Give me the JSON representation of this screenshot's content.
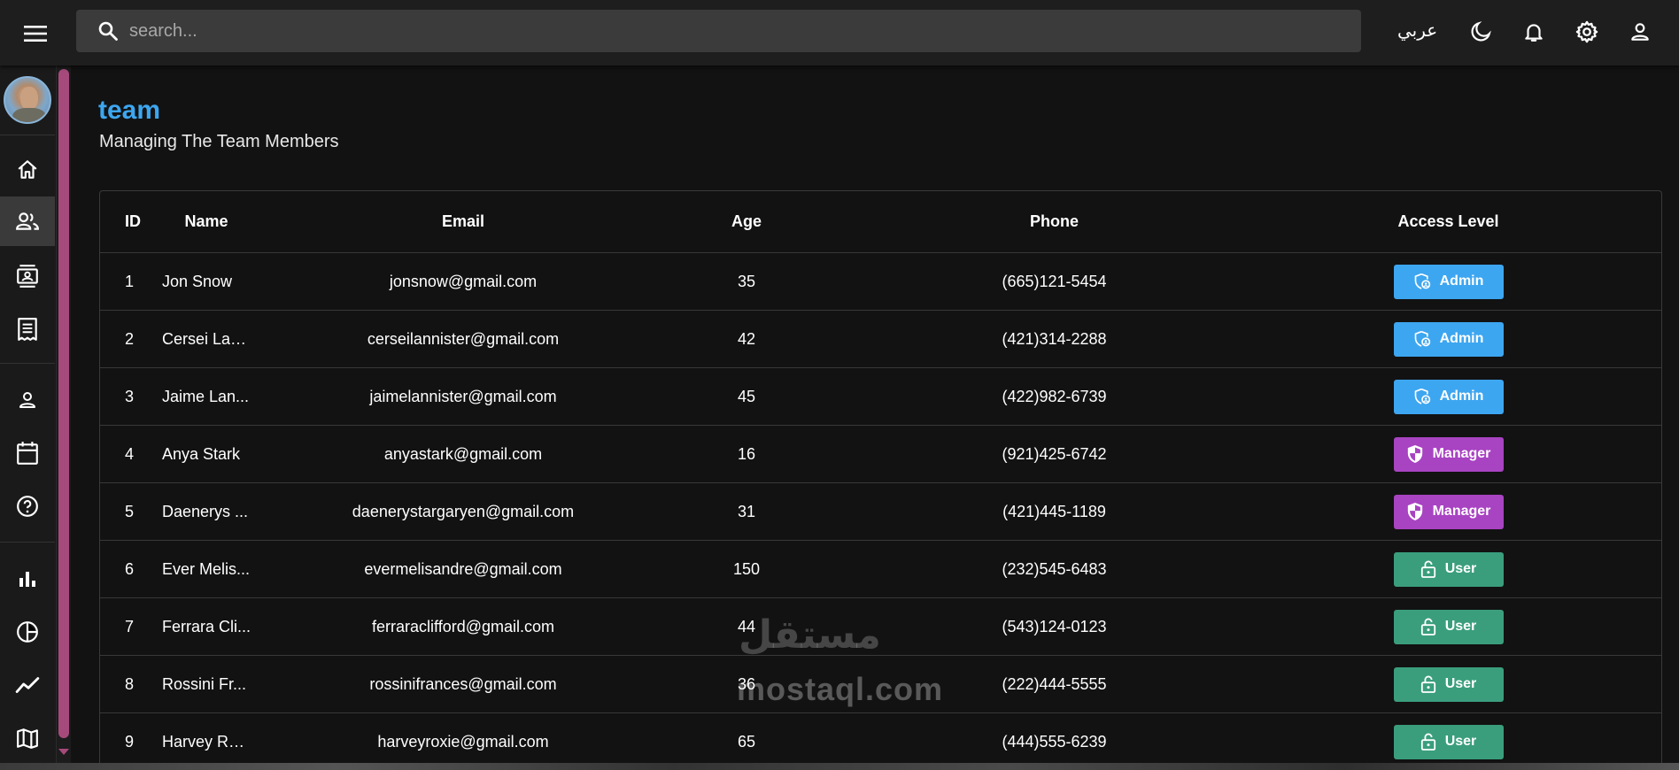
{
  "topbar": {
    "search_placeholder": "search...",
    "language_label": "عربي"
  },
  "sidebar": {
    "items": [
      {
        "icon": "home-icon"
      },
      {
        "icon": "team-icon",
        "active": true
      },
      {
        "icon": "contacts-icon"
      },
      {
        "icon": "invoices-icon"
      },
      {
        "icon": "profile-icon"
      },
      {
        "icon": "calendar-icon"
      },
      {
        "icon": "help-icon"
      },
      {
        "icon": "bar-chart-icon"
      },
      {
        "icon": "pie-chart-icon"
      },
      {
        "icon": "line-chart-icon"
      },
      {
        "icon": "map-icon"
      }
    ]
  },
  "header": {
    "title": "team",
    "subtitle": "Managing The Team Members"
  },
  "table": {
    "columns": [
      "ID",
      "Name",
      "Email",
      "Age",
      "Phone",
      "Access Level"
    ],
    "rows": [
      {
        "id": "1",
        "name": "Jon Snow",
        "email": "jonsnow@gmail.com",
        "age": "35",
        "phone": "(665)121-5454",
        "access": "Admin"
      },
      {
        "id": "2",
        "name": "Cersei Lan...",
        "email": "cerseilannister@gmail.com",
        "age": "42",
        "phone": "(421)314-2288",
        "access": "Admin"
      },
      {
        "id": "3",
        "name": "Jaime Lan...",
        "email": "jaimelannister@gmail.com",
        "age": "45",
        "phone": "(422)982-6739",
        "access": "Admin"
      },
      {
        "id": "4",
        "name": "Anya Stark",
        "email": "anyastark@gmail.com",
        "age": "16",
        "phone": "(921)425-6742",
        "access": "Manager"
      },
      {
        "id": "5",
        "name": "Daenerys ...",
        "email": "daenerystargaryen@gmail.com",
        "age": "31",
        "phone": "(421)445-1189",
        "access": "Manager"
      },
      {
        "id": "6",
        "name": "Ever Melis...",
        "email": "evermelisandre@gmail.com",
        "age": "150",
        "phone": "(232)545-6483",
        "access": "User"
      },
      {
        "id": "7",
        "name": "Ferrara Cli...",
        "email": "ferraraclifford@gmail.com",
        "age": "44",
        "phone": "(543)124-0123",
        "access": "User"
      },
      {
        "id": "8",
        "name": "Rossini Fr...",
        "email": "rossinifrances@gmail.com",
        "age": "36",
        "phone": "(222)444-5555",
        "access": "User"
      },
      {
        "id": "9",
        "name": "Harvey Ro...",
        "email": "harveyroxie@gmail.com",
        "age": "65",
        "phone": "(444)555-6239",
        "access": "User"
      }
    ]
  },
  "colors": {
    "accent": "#3da6f0",
    "admin": "#3da6f0",
    "manager": "#a843c2",
    "user": "#3a9e7d",
    "scrollbar": "#a64a7c"
  },
  "watermark": {
    "arabic": "مستقل",
    "latin": "mostaql.com"
  }
}
